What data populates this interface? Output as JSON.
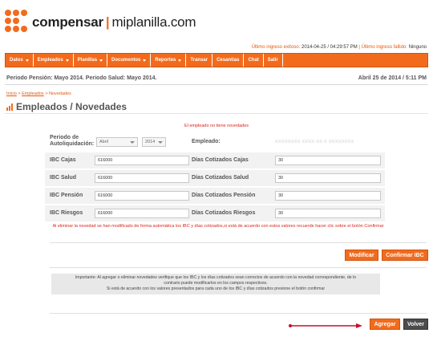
{
  "brand": {
    "name": "compensar",
    "product": "miplanilla.com",
    "separator": "|",
    "color": "#f26b1d"
  },
  "login_info": {
    "success_label": "Último ingreso exitoso:",
    "success_value": "2014-04-25 / 04:29:57 PM",
    "divider": "|",
    "failed_label": "Último ingreso fallido:",
    "failed_value": "Ninguno"
  },
  "nav": {
    "items": [
      {
        "label": "Datos",
        "dropdown": true
      },
      {
        "label": "Empleados",
        "dropdown": true
      },
      {
        "label": "Planillas",
        "dropdown": true
      },
      {
        "label": "Documentos",
        "dropdown": true
      },
      {
        "label": "Reportes",
        "dropdown": true
      },
      {
        "label": "Transar",
        "dropdown": false
      },
      {
        "label": "Cesantias",
        "dropdown": false
      },
      {
        "label": "Chat",
        "dropdown": false
      },
      {
        "label": "Salir",
        "dropdown": false
      }
    ]
  },
  "period": {
    "left": "Periodo Pensión: Mayo 2014. Periodo Salud: Mayo 2014.",
    "right": "Abril 25 de 2014 / 5:11 PM"
  },
  "breadcrumb": {
    "home": "Inicio",
    "sep": ">",
    "section": "Empleados",
    "current": "Novedades"
  },
  "page_title": {
    "part1": "Empleados",
    "sep": " / ",
    "part2": "Novedades"
  },
  "notice_no_news": "El empleado no tiene novedades",
  "form": {
    "period_label": "Periodo de Autoliquidación:",
    "month_value": "Abril",
    "year_value": "2014",
    "employee_label": "Empleado:",
    "employee_value": "XXXXXXXX XXXX XX X XXXXXXXX",
    "rows": [
      {
        "ibc_label": "IBC Cajas",
        "ibc_value": "616000",
        "days_label": "Días Cotizados Cajas",
        "days_value": "30"
      },
      {
        "ibc_label": "IBC Salud",
        "ibc_value": "616000",
        "days_label": "Días Cotizados Salud",
        "days_value": "30"
      },
      {
        "ibc_label": "IBC Pensión",
        "ibc_value": "616000",
        "days_label": "Días Cotizados Pensión",
        "days_value": "30"
      },
      {
        "ibc_label": "IBC Riesgos",
        "ibc_value": "616000",
        "days_label": "Días Cotizados Riesgos",
        "days_value": "30"
      }
    ]
  },
  "notice_delete": "Al eliminar la novedad se han modificado de forma automática los IBC y días cotizados,si está de acuerdo con estos valores recuerde hacer clic sobre el botón Confirmar",
  "buttons": {
    "modify": "Modificar",
    "confirm_ibc": "Confirmar IBC",
    "add": "Agregar",
    "back": "Volver"
  },
  "info": {
    "line1": "Importante: Al agregar o eliminar novedades verifique que los IBC y los días cotizados sean correctos de acuerdo con la novedad correspondiente, de lo",
    "line2": "contrario puede modificarlos en los campos respectivos.",
    "line3": "Si está de acuerdo con los valores presentados para cada uno de los IBC y días cotizados presione el botón confirmar"
  }
}
